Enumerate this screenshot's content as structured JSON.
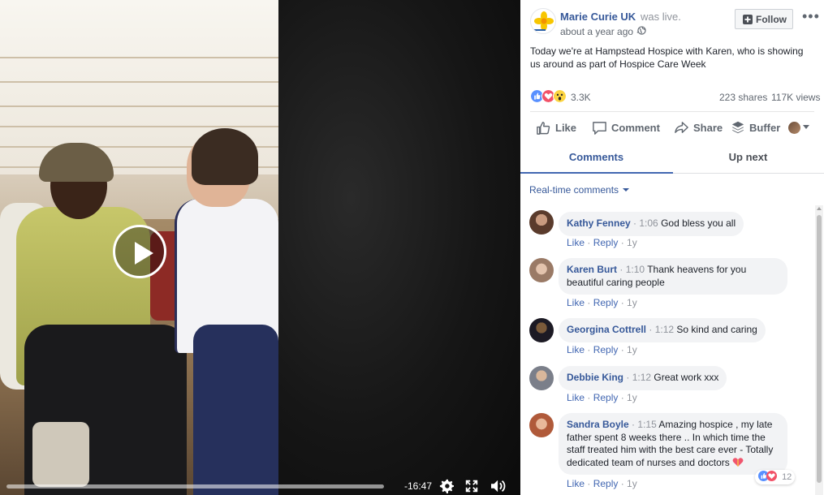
{
  "video": {
    "remaining_time": "-16:47",
    "progress_fraction": 0.0
  },
  "post": {
    "page_name": "Marie Curie UK",
    "status": "was live.",
    "time": "about a year ago",
    "privacy_separator": "·",
    "follow_label": "Follow",
    "text": "Today we're at Hampstead Hospice with Karen, who is showing us around as part of Hospice Care Week",
    "reaction_count": "3.3K",
    "shares": "223 shares",
    "views": "117K views"
  },
  "actions": {
    "like": "Like",
    "comment": "Comment",
    "share": "Share",
    "buffer": "Buffer"
  },
  "tabs": {
    "comments": "Comments",
    "up_next": "Up next"
  },
  "realtime_label": "Real-time comments",
  "comments": [
    {
      "name": "Kathy Fenney",
      "ts": "1:06",
      "text": "God bless you all",
      "like": "Like",
      "reply": "Reply",
      "age": "1y"
    },
    {
      "name": "Karen Burt",
      "ts": "1:10",
      "text": "Thank heavens for you",
      "text2": "beautiful caring people",
      "like": "Like",
      "reply": "Reply",
      "age": "1y"
    },
    {
      "name": "Georgina Cottrell",
      "ts": "1:12",
      "text": "So kind and caring",
      "like": "Like",
      "reply": "Reply",
      "age": "1y"
    },
    {
      "name": "Debbie King",
      "ts": "1:12",
      "text": "Great work xxx",
      "like": "Like",
      "reply": "Reply",
      "age": "1y"
    },
    {
      "name": "Sandra Boyle",
      "ts": "1:15",
      "text": "Amazing hospice , my late",
      "text2": "father spent 8 weeks there .. In which time the",
      "text3": "staff treated him with the best care ever - Totally",
      "text4": "dedicated team of nurses and doctors",
      "reaction_count": "12",
      "like": "Like",
      "reply": "Reply",
      "age": "1y"
    }
  ],
  "colors": {
    "link_blue": "#365899",
    "action_blue": "#4267b2",
    "meta_gray": "#90949c",
    "bubble_gray": "#f2f3f5"
  },
  "icons": [
    "play-icon",
    "settings-icon",
    "fullscreen-icon",
    "volume-icon",
    "globe-icon",
    "follow-plus-icon",
    "more-icon",
    "like-reaction-icon",
    "love-reaction-icon",
    "wow-reaction-icon",
    "thumbs-up-icon",
    "comment-icon",
    "share-icon",
    "buffer-icon",
    "caret-down-icon"
  ]
}
